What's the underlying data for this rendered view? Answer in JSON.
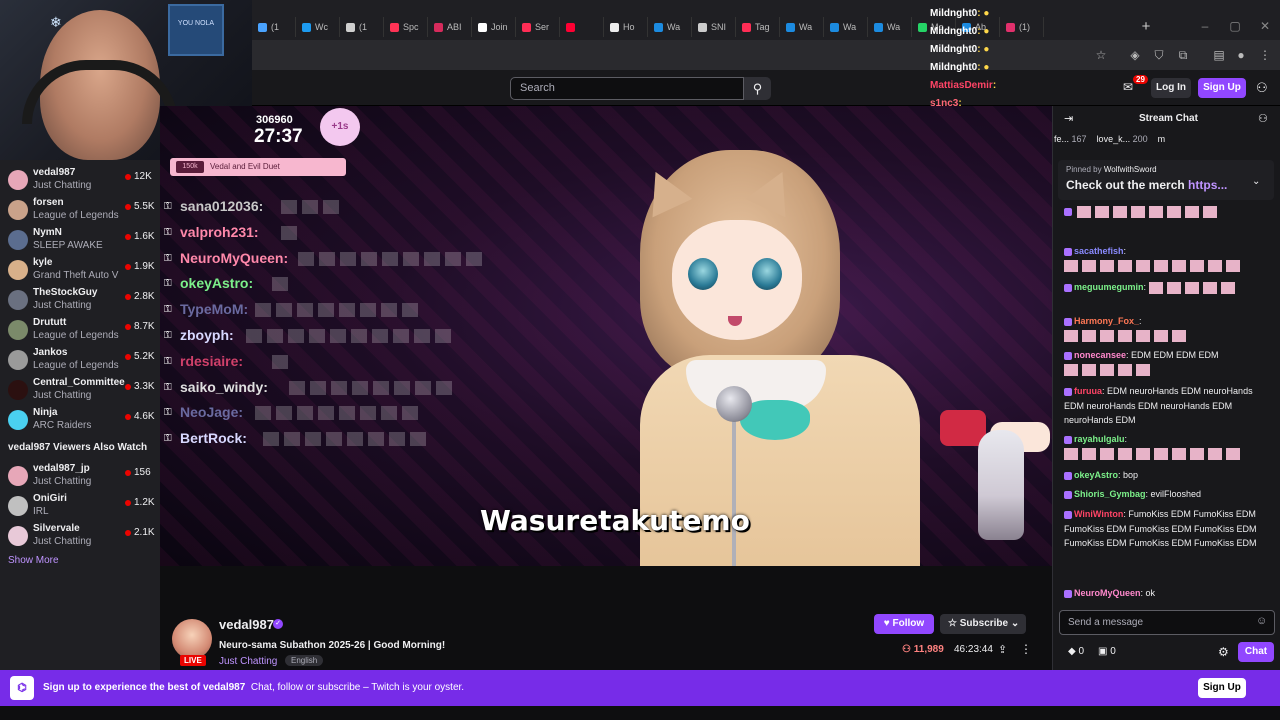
{
  "browser": {
    "tabs": [
      {
        "label": "(1",
        "color": "#4aa3ff"
      },
      {
        "label": "Wc",
        "color": "#1d9bf0"
      },
      {
        "label": "(1",
        "color": "#cfcfcf"
      },
      {
        "label": "Spc",
        "color": "#ff3355"
      },
      {
        "label": "ABI",
        "color": "#d62b5c"
      },
      {
        "label": "Join",
        "color": "#ffffff"
      },
      {
        "label": "Ser",
        "color": "#ff2d55"
      },
      {
        "label": "",
        "color": "#ff0033"
      },
      {
        "label": "Ho",
        "color": "#eeeeee"
      },
      {
        "label": "Wa",
        "color": "#1c8be0"
      },
      {
        "label": "SNI",
        "color": "#cccccc"
      },
      {
        "label": "Tag",
        "color": "#ff2d55"
      },
      {
        "label": "Wa",
        "color": "#1c8be0"
      },
      {
        "label": "Wa",
        "color": "#1c8be0"
      },
      {
        "label": "Wa",
        "color": "#1c8be0"
      },
      {
        "label": "Mo",
        "color": "#25d366"
      },
      {
        "label": "Ab",
        "color": "#1c8be0"
      },
      {
        "label": "(1)",
        "color": "#e1306c"
      }
    ],
    "new_tab": "+"
  },
  "overlay_chat": [
    {
      "name": "Mildnght0",
      "suffix": ": ●",
      "color": "#ffffff"
    },
    {
      "name": "Mildnght0",
      "suffix": ": ●",
      "color": "#ffffff"
    },
    {
      "name": "Mildnght0",
      "suffix": ": ●",
      "color": "#ffffff"
    },
    {
      "name": "Mildnght0",
      "suffix": ": ●",
      "color": "#ffffff"
    },
    {
      "name": "MattiasDemir",
      "suffix": ":",
      "color": "#ff4466"
    },
    {
      "name": "s1nc3",
      "suffix": ":",
      "color": "#ff6677"
    },
    {
      "name": "s1nc3",
      "suffix": ":",
      "color": "#ff6677"
    }
  ],
  "webcam": {
    "frame_label": "YOU NOLA"
  },
  "topnav": {
    "search_placeholder": "Search",
    "inbox_count": "29",
    "login": "Log In",
    "signup": "Sign Up"
  },
  "sidebar": {
    "channels": [
      {
        "name": "vedal987",
        "game": "Just Chatting",
        "viewers": "12K",
        "avatar": "#e7a7b8"
      },
      {
        "name": "forsen",
        "game": "League of Legends",
        "viewers": "5.5K",
        "avatar": "#c9a28a"
      },
      {
        "name": "NymN",
        "game": "SLEEP AWAKE",
        "viewers": "1.6K",
        "avatar": "#5b6d8f"
      },
      {
        "name": "kyle",
        "game": "Grand Theft Auto V",
        "viewers": "1.9K",
        "avatar": "#d8b08a"
      },
      {
        "name": "TheStockGuy",
        "game": "Just Chatting",
        "viewers": "2.8K",
        "avatar": "#6a7080"
      },
      {
        "name": "Drututt",
        "game": "League of Legends",
        "viewers": "8.7K",
        "avatar": "#7b8a6a"
      },
      {
        "name": "Jankos",
        "game": "League of Legends",
        "viewers": "5.2K",
        "avatar": "#9a9a9a"
      },
      {
        "name": "Central_Committee",
        "game": "Just Chatting",
        "viewers": "3.3K",
        "avatar": "#2b1010"
      },
      {
        "name": "Ninja",
        "game": "ARC Raiders",
        "viewers": "4.6K",
        "avatar": "#4ad0f0"
      }
    ],
    "also_watch_title": "vedal987 Viewers Also Watch",
    "also_watch": [
      {
        "name": "vedal987_jp",
        "game": "Just Chatting",
        "viewers": "156",
        "avatar": "#e7a7b8"
      },
      {
        "name": "OniGiri",
        "game": "IRL",
        "viewers": "1.2K",
        "avatar": "#c0c0c0"
      },
      {
        "name": "Silvervale",
        "game": "Just Chatting",
        "viewers": "2.1K",
        "avatar": "#e8c9d8"
      }
    ],
    "show_more": "Show More"
  },
  "video": {
    "counter": "306960",
    "timer": "27:37",
    "plus": "+1s",
    "banner_tag": "150k",
    "banner_text": "Vedal and Evil Duet",
    "caption": "Wasuretakutemo",
    "overlay_messages": [
      {
        "name": "sana012036:",
        "color": "#c8c8c8",
        "emotes": 3
      },
      {
        "name": "valproh231:",
        "color": "#ff88aa",
        "emotes": 1
      },
      {
        "name": "NeuroMyQueen:",
        "color": "#ff88aa",
        "emotes": 9
      },
      {
        "name": "okeyAstro:",
        "color": "#7cf08a",
        "emotes": 1
      },
      {
        "name": "TypeMoM:",
        "color": "#6a6aa0",
        "emotes": 8
      },
      {
        "name": "zboyph:",
        "color": "#d8d8ff",
        "emotes": 10
      },
      {
        "name": "rdesiaire:",
        "color": "#d0406a",
        "emotes": 1
      },
      {
        "name": "saiko_windy:",
        "color": "#e0e0e0",
        "emotes": 8
      },
      {
        "name": "NeoJage:",
        "color": "#6a6aa0",
        "emotes": 8
      },
      {
        "name": "BertRock:",
        "color": "#d8d8ff",
        "emotes": 8
      }
    ]
  },
  "stream_info": {
    "channel": "vedal987",
    "live": "LIVE",
    "title": "Neuro-sama Subathon 2025-26 | Good Morning!",
    "category": "Just Chatting",
    "language": "English",
    "follow": "Follow",
    "subscribe": "Subscribe",
    "viewers": "11,989",
    "uptime": "46:23:44"
  },
  "chat": {
    "title": "Stream Chat",
    "leaderboard": [
      {
        "name": "fe...",
        "value": "167"
      },
      {
        "name": "love_k...",
        "value": "200"
      },
      {
        "name": "m",
        "value": ""
      }
    ],
    "pinned_by": "Pinned by",
    "pinned_user": "WolfwithSword",
    "pinned_text": "Check out the merch",
    "pinned_link": "https...",
    "messages": [
      {
        "user": "",
        "color": "#ff88cc",
        "text": "",
        "emotes": 8
      },
      {
        "user": "sacathefish",
        "color": "#8a8aff",
        "text": ":",
        "emotes": 10
      },
      {
        "user": "meguumegumin",
        "color": "#7cf08a",
        "text": ":",
        "emotes": 5
      },
      {
        "user": "Harmony_Fox_",
        "color": "#ff7755",
        "text": ":",
        "emotes": 7
      },
      {
        "user": "nonecansee",
        "color": "#ff88cc",
        "text": ": EDM EDM EDM EDM",
        "emotes": 5
      },
      {
        "user": "furuua",
        "color": "#ff4466",
        "text": ": EDM neuroHands EDM neuroHands EDM neuroHands EDM neuroHands EDM neuroHands EDM",
        "emotes": 0
      },
      {
        "user": "rayahulgalu",
        "color": "#7cf08a",
        "text": ":",
        "emotes": 12
      },
      {
        "user": "okeyAstro",
        "color": "#7cf08a",
        "text": ": bop",
        "emotes": 0
      },
      {
        "user": "Shioris_Gymbag",
        "color": "#7cf08a",
        "text": ": evilFlooshed",
        "emotes": 0
      },
      {
        "user": "WiniWinton",
        "color": "#ff4466",
        "text": ": FumoKiss EDM FumoKiss EDM FumoKiss EDM FumoKiss EDM FumoKiss EDM FumoKiss EDM FumoKiss EDM FumoKiss EDM",
        "emotes": 0
      },
      {
        "user": "NeuroMyQueen",
        "color": "#ff88cc",
        "text": ": ok",
        "emotes": 0
      }
    ],
    "input_placeholder": "Send a message",
    "bits": "0",
    "points": "0",
    "chat_button": "Chat"
  },
  "bottom_banner": {
    "text_bold": "Sign up to experience the best of vedal987",
    "text": "Chat, follow or subscribe – Twitch is your oyster.",
    "signup": "Sign Up"
  },
  "colors": {
    "accent": "#9147ff",
    "live": "#eb0400",
    "banner": "#772ce8"
  }
}
